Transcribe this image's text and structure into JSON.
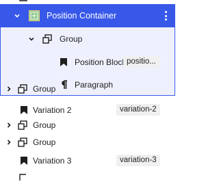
{
  "colors": {
    "accent": "#3858e9",
    "icon_green_bg": "#8ec78b"
  },
  "tree": {
    "position_container": {
      "label": "Position Container",
      "icon": "position-icon",
      "options_icon": "more-vertical-icon"
    },
    "group_inner": {
      "label": "Group",
      "icon": "group-icon"
    },
    "position_block": {
      "label": "Position Block",
      "badge": "positio...",
      "icon": "bookmark-icon"
    },
    "paragraph": {
      "label": "Paragraph",
      "icon": "paragraph-icon"
    },
    "group_1": {
      "label": "Group",
      "icon": "group-icon"
    },
    "variation_2": {
      "label": "Variation 2",
      "badge": "variation-2",
      "icon": "bookmark-icon"
    },
    "group_2": {
      "label": "Group",
      "icon": "group-icon"
    },
    "group_3": {
      "label": "Group",
      "icon": "group-icon"
    },
    "variation_3": {
      "label": "Variation 3",
      "badge": "variation-3",
      "icon": "bookmark-icon"
    }
  }
}
